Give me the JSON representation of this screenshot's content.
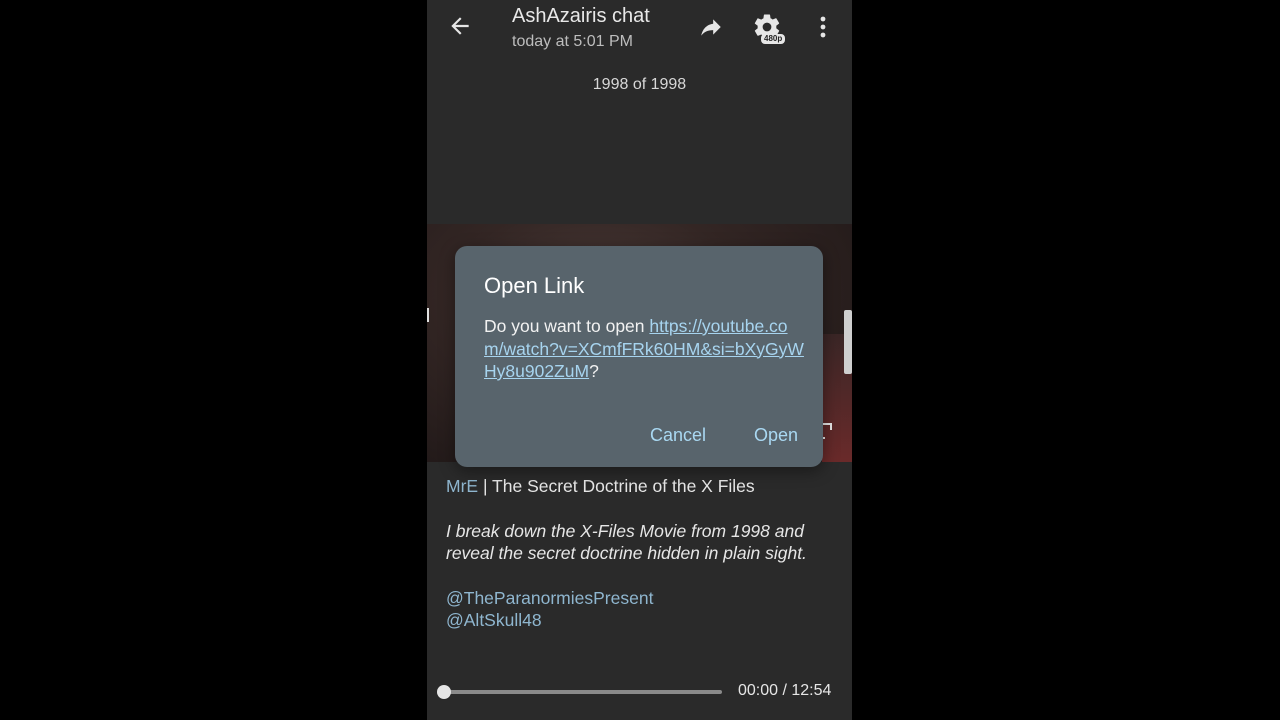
{
  "header": {
    "title": "AshAzairis chat",
    "subtitle": "today at 5:01 PM",
    "quality_badge": "480p",
    "icons": [
      "back-arrow-icon",
      "share-icon",
      "gear-icon",
      "more-vert-icon"
    ]
  },
  "counter": "1998 of 1998",
  "caption": {
    "author": "MrE",
    "separator": " | ",
    "title": "The Secret Doctrine of the X Files",
    "description": "I break down the X-Files Movie from 1998 and reveal the secret doctrine hidden in plain sight.",
    "mentions": [
      "@TheParanormiesPresent",
      "@AltSkull48"
    ]
  },
  "player": {
    "time": "00:00 / 12:54",
    "progress": 0
  },
  "dialog": {
    "title": "Open Link",
    "prefix": "Do you want to open ",
    "link": "https://youtube.com/watch?v=XCmfFRk60HM&si=bXyGyWHy8u902ZuM",
    "suffix": "?",
    "cancel_label": "Cancel",
    "open_label": "Open"
  },
  "colors": {
    "background": "#2a2a2a",
    "dialog": "#58646c",
    "accent": "#a9d8f2",
    "link_text": "#8fb6cf"
  }
}
